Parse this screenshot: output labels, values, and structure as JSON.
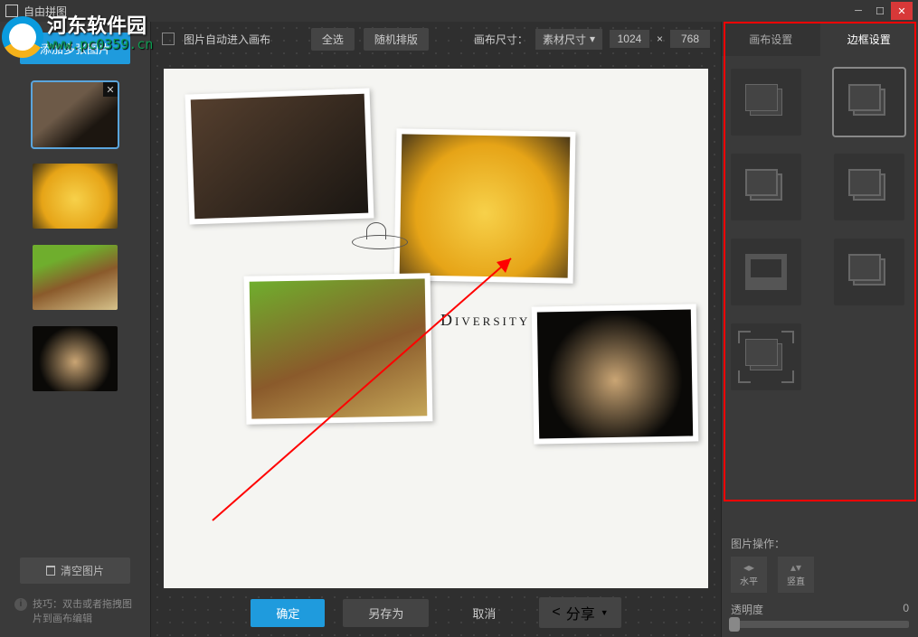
{
  "window": {
    "title": "自由拼图"
  },
  "watermark": {
    "brand": "河东软件园",
    "url": "www.pc0359.cn"
  },
  "left": {
    "add_button": "添加多张图片",
    "clear_button": "清空图片",
    "tip_label": "技巧：",
    "tip_text": "双击或者拖拽图片到画布编辑",
    "thumbs": [
      "kitten",
      "duckling",
      "squirrel",
      "cheetah-cub"
    ]
  },
  "toolbar": {
    "auto_enter": "图片自动进入画布",
    "select_all": "全选",
    "random": "随机排版",
    "size_label": "画布尺寸：",
    "size_mode": "素材尺寸",
    "width": "1024",
    "sep": "×",
    "height": "768"
  },
  "canvas": {
    "deco_text": "Diversity"
  },
  "bottom": {
    "ok": "确定",
    "save_as": "另存为",
    "cancel": "取消",
    "share": "分享"
  },
  "right": {
    "tab_canvas": "画布设置",
    "tab_frame": "边框设置",
    "ops_title": "图片操作：",
    "flip_h": "水平",
    "flip_v": "竖直",
    "opacity_label": "透明度",
    "opacity_value": "0"
  }
}
